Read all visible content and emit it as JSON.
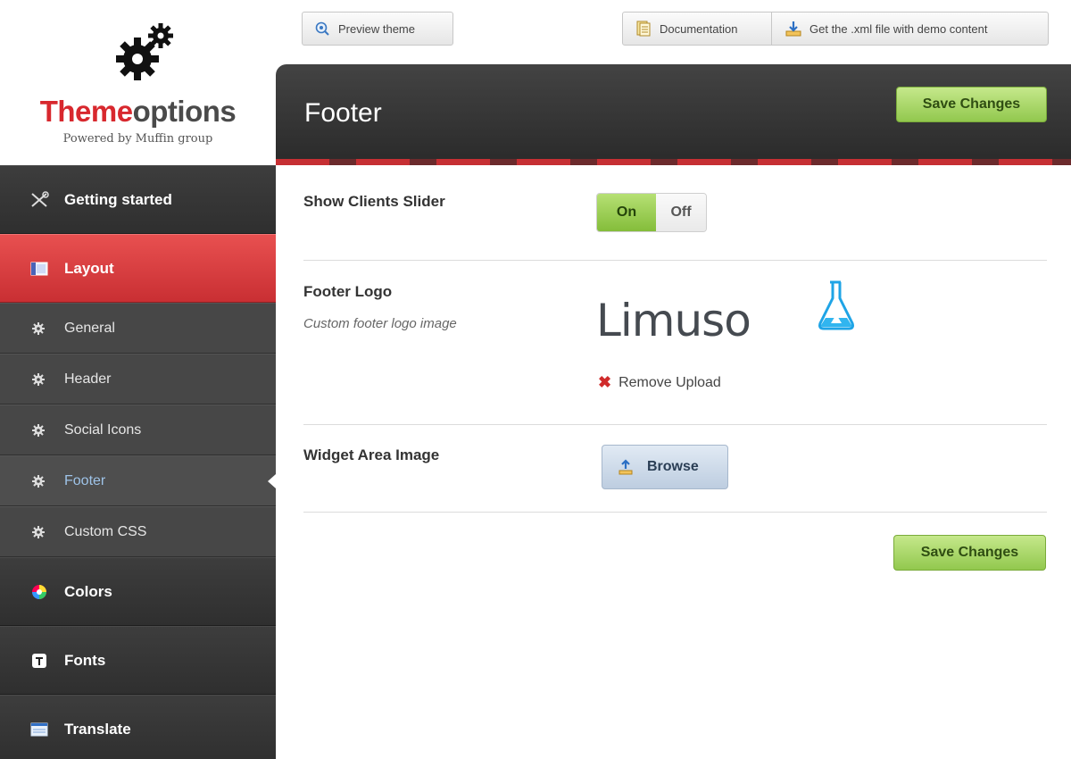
{
  "logo": {
    "title_part1": "Theme",
    "title_part2": "options",
    "subtitle": "Powered by Muffin group"
  },
  "toolbar": {
    "preview_label": "Preview theme",
    "documentation_label": "Documentation",
    "xml_label": "Get the .xml file with demo content"
  },
  "sidebar": {
    "items": [
      {
        "label": "Getting started",
        "icon": "tools-icon"
      },
      {
        "label": "Layout",
        "icon": "layout-icon",
        "active": true
      },
      {
        "label": "Colors",
        "icon": "color-wheel-icon"
      },
      {
        "label": "Fonts",
        "icon": "font-icon"
      },
      {
        "label": "Translate",
        "icon": "translate-icon"
      }
    ],
    "sub_items": [
      {
        "label": "General"
      },
      {
        "label": "Header"
      },
      {
        "label": "Social Icons"
      },
      {
        "label": "Footer",
        "current": true
      },
      {
        "label": "Custom CSS"
      }
    ]
  },
  "header": {
    "title": "Footer",
    "save_label": "Save Changes"
  },
  "content": {
    "clients_slider": {
      "label": "Show Clients Slider",
      "on_label": "On",
      "off_label": "Off",
      "value": "On"
    },
    "footer_logo": {
      "label": "Footer Logo",
      "description": "Custom footer logo image",
      "logo_text": "Limuso",
      "remove_label": "Remove Upload"
    },
    "widget_area_image": {
      "label": "Widget Area Image",
      "browse_label": "Browse"
    },
    "save_label": "Save Changes"
  },
  "colors": {
    "brand_red": "#d8282e",
    "save_green": "#92c84e",
    "header_dark": "#2a2a2a",
    "sidebar_dark": "#3a3a3a",
    "active_link_blue": "#9ec3e8"
  }
}
